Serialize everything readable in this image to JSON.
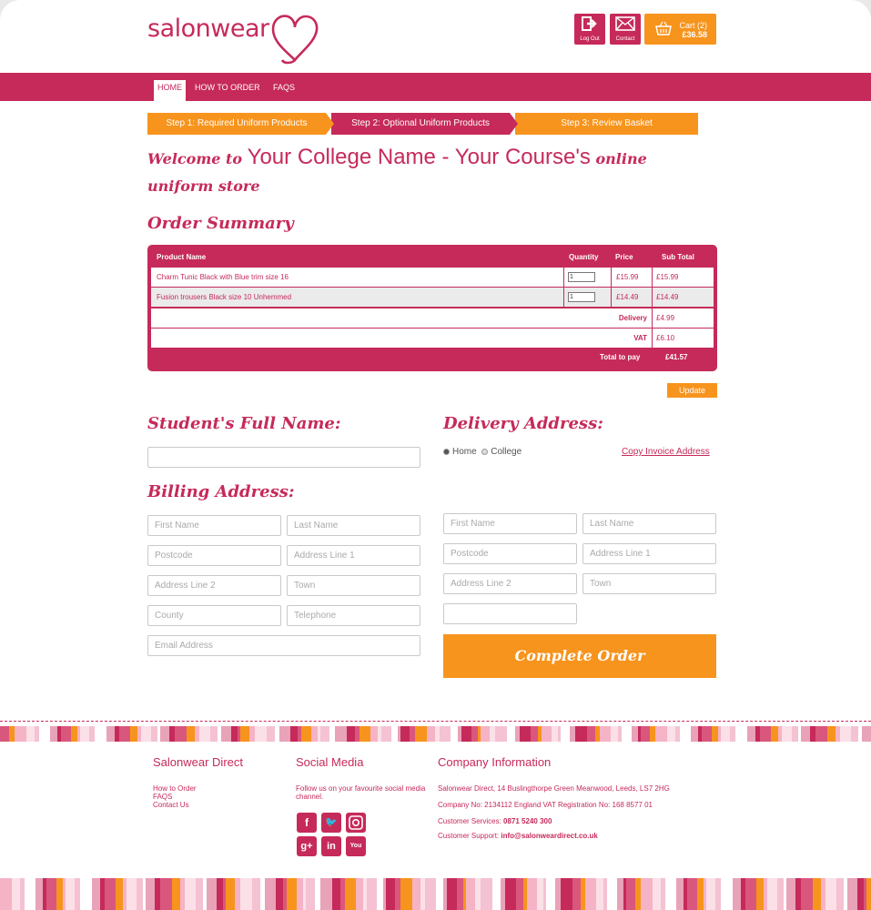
{
  "header": {
    "logo_text": "salonwear",
    "logout_label": "Log Out",
    "contact_label": "Contact",
    "cart_label": "Cart (2)",
    "cart_total": "£36.58"
  },
  "nav": {
    "items": [
      "HOME",
      "HOW TO ORDER",
      "FAQS"
    ]
  },
  "steps": [
    "Step 1: Required Uniform Products",
    "Step 2: Optional Uniform Products",
    "Step 3: Review Basket"
  ],
  "welcome": {
    "prefix": "Welcome to",
    "name": "Your College Name - Your Course's",
    "suffix": "online uniform store"
  },
  "order_summary": {
    "title": "Order Summary",
    "columns": [
      "Product Name",
      "Quantity",
      "Price",
      "Sub Total"
    ],
    "rows": [
      {
        "product": "Charm Tunic Black with Blue trim size 16",
        "qty": "1",
        "price": "£15.99",
        "subtotal": "£15.99"
      },
      {
        "product": "Fusion trousers Black size 10 Unhemmed",
        "qty": "1",
        "price": "£14.49",
        "subtotal": "£14.49"
      }
    ],
    "delivery_label": "Delivery",
    "delivery_value": "£4.99",
    "vat_label": "VAT",
    "vat_value": "£6.10",
    "total_label": "Total to pay",
    "total_value": "£41.57"
  },
  "update_label": "Update",
  "student_heading": "Student's Full Name:",
  "billing_heading": "Billing Address:",
  "delivery_heading": "Delivery Address:",
  "delivery_options": {
    "home": "Home",
    "college": "College"
  },
  "copy_invoice_label": "Copy Invoice Address",
  "placeholders": {
    "first_name": "First Name",
    "last_name": "Last Name",
    "postcode": "Postcode",
    "address1": "Address Line 1",
    "address2": "Address Line 2",
    "town": "Town",
    "county": "County",
    "telephone": "Telephone",
    "email": "Email Address"
  },
  "complete_label": "Complete Order",
  "footer": {
    "col1_heading": "Salonwear Direct",
    "col1_links": [
      "How to Order",
      "FAQS",
      "Contact Us"
    ],
    "col2_heading": "Social Media",
    "col2_text": "Follow us on your favourite social media channel.",
    "col3_heading": "Company Information",
    "address": "Salonwear Direct, 14 Buslingthorpe Green Meanwood, Leeds, LS7 2HG",
    "company_no": "Company No: 2134112 England VAT Registration No: 168 8577 01",
    "services_label": "Customer Services:",
    "services_phone": "0871 5240 300",
    "support_label": "Customer Support:",
    "support_email": "info@salonweardirect.co.uk"
  },
  "colors": {
    "brand": "#c62a5a",
    "accent": "#f7941d"
  }
}
